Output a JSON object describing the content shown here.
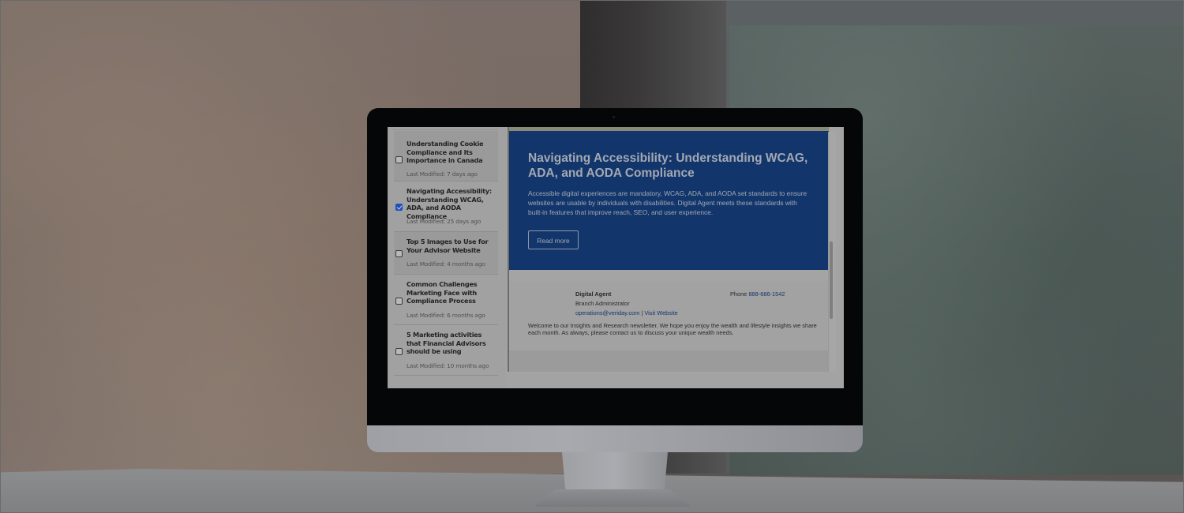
{
  "sidebar": {
    "articles": [
      {
        "title": "Understanding Cookie Compliance and Its Importance in Canada",
        "last_modified": "Last Modified: 7 days ago",
        "checked": false
      },
      {
        "title": "Navigating Accessibility: Understanding WCAG, ADA, and AODA Compliance",
        "last_modified": "Last Modified: 25 days ago",
        "checked": true
      },
      {
        "title": "Top 5 Images to Use for Your Advisor Website",
        "last_modified": "Last Modified: 4 months ago",
        "checked": false
      },
      {
        "title": "Common Challenges Marketing Face with Compliance Process",
        "last_modified": "Last Modified: 6 months ago",
        "checked": false
      },
      {
        "title": "5 Marketing activities that Financial Advisors should be using",
        "last_modified": "Last Modified: 10 months ago",
        "checked": false
      }
    ]
  },
  "preview": {
    "hero": {
      "title": "Navigating Accessibility: Understanding WCAG, ADA, and AODA Compliance",
      "body": "Accessible digital experiences are mandatory, WCAG, ADA, and AODA set standards to ensure websites are usable by individuals with disabilities. Digital Agent meets these standards with built-in features that improve reach, SEO, and user experience.",
      "button_label": "Read more"
    },
    "signature": {
      "name": "Digital Agent",
      "role": "Branch Administrator",
      "email": "operations@veriday.com",
      "separator": " | ",
      "website_label": "Visit Website",
      "phone_label": "Phone ",
      "phone": "888-686-1542",
      "welcome": "Welcome to our Insights and Research newsletter. We hope you enjoy the wealth and lifestyle insights we share each month. As always, please contact us to discuss your unique wealth needs."
    }
  },
  "colors": {
    "hero_bg": "#12366b",
    "checkbox_checked": "#1e4fb8",
    "link": "#16356d"
  }
}
